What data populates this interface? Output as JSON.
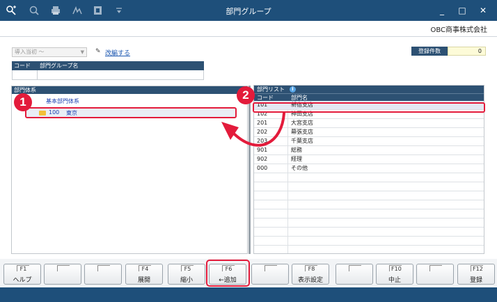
{
  "window": {
    "title": "部門グループ",
    "company": "OBC商事株式会社",
    "controls": {
      "minimize": "_",
      "maximize": "□",
      "close": "✕"
    },
    "toolbar_icons": [
      "search-plus-icon",
      "search-icon",
      "print-icon",
      "signature-icon",
      "export-icon",
      "dropdown-icon"
    ]
  },
  "form": {
    "period_select": "導入当初 〜",
    "relink_label": "改編する",
    "group_table": {
      "headers": [
        "コード",
        "部門グループ名"
      ]
    },
    "registration_label": "登録件数",
    "registration_count": "0"
  },
  "left_panel": {
    "title": "部門体系",
    "tree_root": "基本部門体系",
    "tree_node": {
      "code": "100",
      "name": "東京"
    }
  },
  "right_panel": {
    "title": "部門リスト",
    "headers": {
      "code": "コード",
      "name": "部門名"
    },
    "rows": [
      {
        "code": "101",
        "name": "新宿支店"
      },
      {
        "code": "102",
        "name": "神田支店"
      },
      {
        "code": "201",
        "name": "大宮支店"
      },
      {
        "code": "202",
        "name": "幕張支店"
      },
      {
        "code": "203",
        "name": "千葉支店"
      },
      {
        "code": "901",
        "name": "総務"
      },
      {
        "code": "902",
        "name": "経理"
      },
      {
        "code": "000",
        "name": "その他"
      }
    ]
  },
  "badges": {
    "one": "1",
    "two": "2"
  },
  "fkeys": [
    {
      "key": "F1",
      "label": "ヘルプ"
    },
    {
      "key": "",
      "label": ""
    },
    {
      "key": "",
      "label": ""
    },
    {
      "key": "F4",
      "label": "展開"
    },
    {
      "key": "F5",
      "label": "縮小"
    },
    {
      "key": "F6",
      "label": "←追加"
    },
    {
      "key": "",
      "label": ""
    },
    {
      "key": "F8",
      "label": "表示設定"
    },
    {
      "key": "",
      "label": ""
    },
    {
      "key": "F10",
      "label": "中止"
    },
    {
      "key": "",
      "label": ""
    },
    {
      "key": "F12",
      "label": "登録"
    }
  ],
  "colors": {
    "titlebar": "#1e4f7a",
    "header": "#2d5173",
    "highlight": "#e31b3b",
    "link": "#1a56b0"
  }
}
